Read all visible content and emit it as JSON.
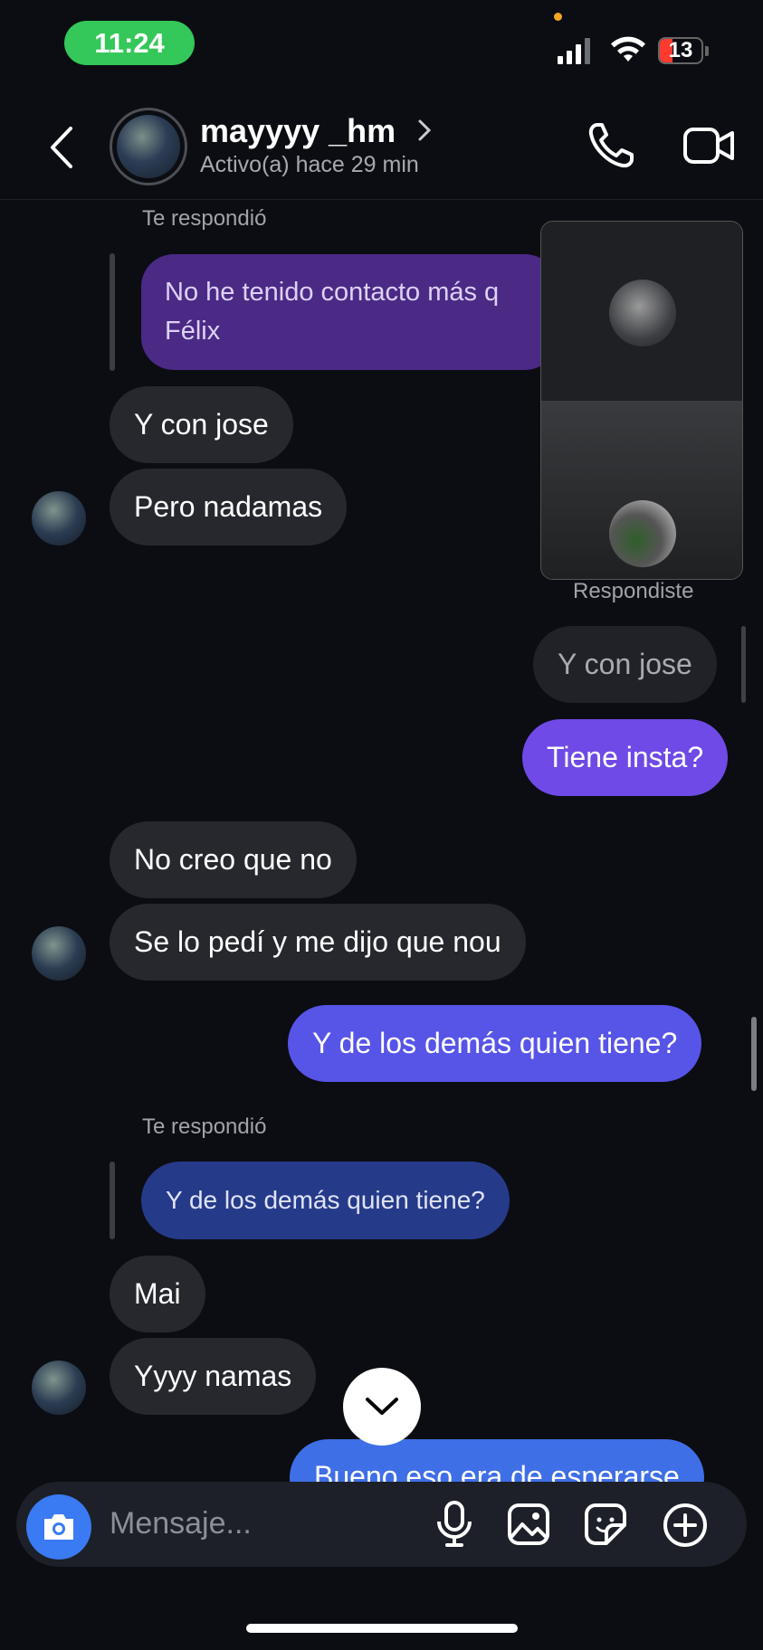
{
  "status_bar": {
    "time": "11:24",
    "battery": "13"
  },
  "header": {
    "username": "mayyyy _hm",
    "activity": "Activo(a) hace 29 min"
  },
  "messages": {
    "reply_label_1": "Te respondió",
    "quoted_1": "No he tenido contacto más q",
    "quoted_1_line2": "Félix",
    "m1": "Y con jose",
    "m2": "Pero nadamas",
    "reply_label_2": "Respondiste",
    "quoted_2": "Y con jose",
    "m3": "Tiene insta?",
    "m4": "No creo que no",
    "m5": "Se lo pedí y me dijo que nou",
    "m6": "Y de los demás quien tiene?",
    "reply_label_3": "Te respondió",
    "quoted_3": "Y de los demás quien tiene?",
    "m7": "Mai",
    "m8": "Yyyy namas",
    "m9": "Bueno eso era de esperarse"
  },
  "composer": {
    "placeholder": "Mensaje..."
  },
  "colors": {
    "purple_quote": "#4b2a86",
    "outgoing_violet": "#6f4ae6",
    "outgoing_indigo": "#5754e8",
    "outgoing_blue": "#3f6fe6",
    "quote_navy": "#263a8a",
    "camera_blue": "#3a7af2"
  },
  "icons": [
    "back-arrow-icon",
    "chevron-right-icon",
    "phone-icon",
    "video-camera-icon",
    "camera-icon",
    "microphone-icon",
    "gallery-icon",
    "sticker-icon",
    "plus-circle-icon",
    "chevron-down-icon"
  ]
}
